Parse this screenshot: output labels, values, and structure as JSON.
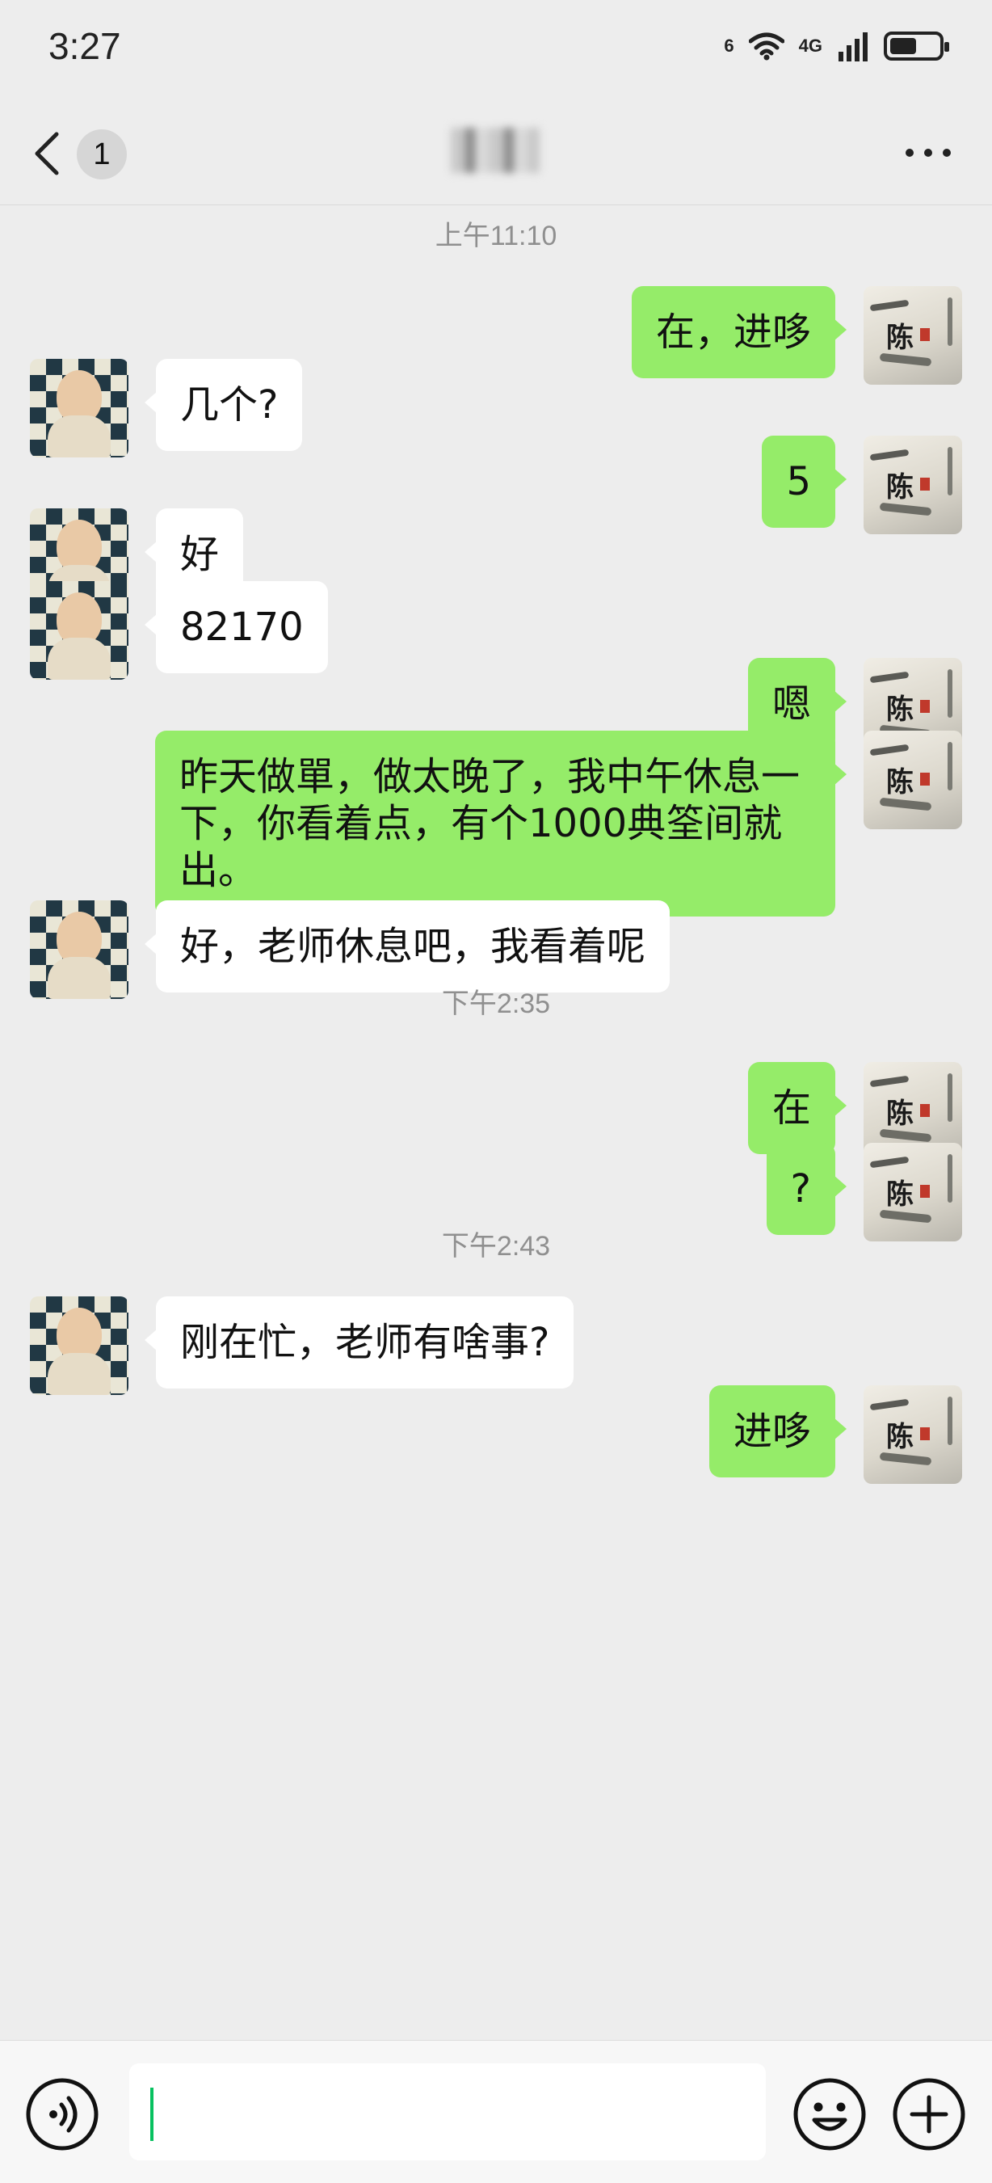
{
  "status_bar": {
    "time": "3:27",
    "wifi_label": "6",
    "network_label": "4G",
    "battery_level": 0.55
  },
  "nav": {
    "back_icon": "chevron-left-icon",
    "unread_count": "1",
    "contact_name": "",
    "more_icon": "ellipsis-icon"
  },
  "messages": [
    {
      "type": "time",
      "text": "上午11:10"
    },
    {
      "type": "msg",
      "sender": "me",
      "text": "在，进哆"
    },
    {
      "type": "msg",
      "sender": "them",
      "text": "几个?"
    },
    {
      "type": "msg",
      "sender": "me",
      "text": "5"
    },
    {
      "type": "msg",
      "sender": "them",
      "text": "好"
    },
    {
      "type": "msg",
      "sender": "them",
      "text": "82170"
    },
    {
      "type": "msg",
      "sender": "me",
      "text": "嗯"
    },
    {
      "type": "msg",
      "sender": "me",
      "text": "昨天做單，做太晚了，我中午休息一下，你看着点，有个1000典筌间就出。"
    },
    {
      "type": "msg",
      "sender": "them",
      "text": "好，老师休息吧，我看着呢"
    },
    {
      "type": "time",
      "text": "下午2:35"
    },
    {
      "type": "msg",
      "sender": "me",
      "text": "在"
    },
    {
      "type": "msg",
      "sender": "me",
      "text": "?"
    },
    {
      "type": "time",
      "text": "下午2:43"
    },
    {
      "type": "msg",
      "sender": "them",
      "text": "刚在忙，老师有啥事?"
    },
    {
      "type": "msg",
      "sender": "me",
      "text": "进哆"
    }
  ],
  "input_bar": {
    "voice_icon": "voice-icon",
    "input_value": "",
    "emoji_icon": "emoji-icon",
    "plus_icon": "plus-icon"
  },
  "colors": {
    "background": "#ededed",
    "my_bubble": "#95ec69",
    "their_bubble": "#ffffff",
    "cursor": "#07c160"
  }
}
